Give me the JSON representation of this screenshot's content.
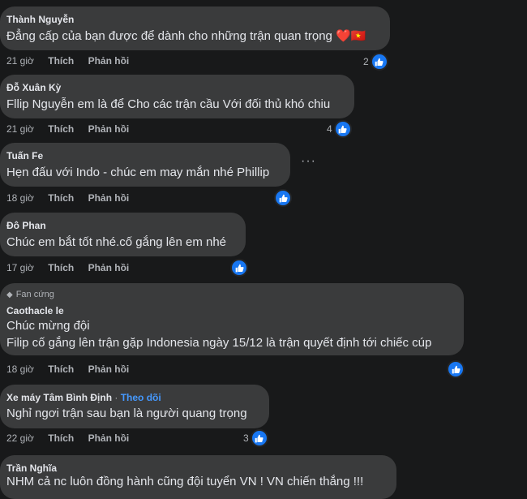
{
  "comments": [
    {
      "name": "Thành Nguyễn",
      "text": "Đẳng cấp của bạn được để dành cho những trận quan trọng",
      "emoji": "❤️🇻🇳",
      "time": "21 giờ",
      "like_label": "Thích",
      "reply_label": "Phản hồi",
      "reactions": "2"
    },
    {
      "name": "Đỗ Xuân Kỳ",
      "text": "Fllip Nguyễn em là để Cho các trận cầu Với đối thủ khó chiu",
      "time": "21 giờ",
      "like_label": "Thích",
      "reply_label": "Phản hồi",
      "reactions": "4"
    },
    {
      "name": "Tuấn Fe",
      "text": "Hẹn đấu với Indo - chúc em may mắn nhé Phillip",
      "time": "18 giờ",
      "like_label": "Thích",
      "reply_label": "Phản hồi",
      "reactions": "",
      "more": "···"
    },
    {
      "name": "Đô Phan",
      "text": "Chúc em bắt tốt nhé.cố gắng lên em nhé",
      "time": "17 giờ",
      "like_label": "Thích",
      "reply_label": "Phản hồi",
      "reactions": ""
    },
    {
      "badge": "Fan cứng",
      "name": "Caothacle le",
      "text1": "Chúc mừng đội",
      "text2": "Filip cố gắng lên trận gặp Indonesia ngày 15/12 là trận quyết định tới chiếc cúp",
      "time": "18 giờ",
      "like_label": "Thích",
      "reply_label": "Phản hồi",
      "reactions": ""
    },
    {
      "name": "Xe máy Tâm Bình Định",
      "separator": "·",
      "follow": "Theo dõi",
      "text": "Nghỉ ngơi trận sau bạn là người quang trọng",
      "time": "22 giờ",
      "like_label": "Thích",
      "reply_label": "Phản hồi",
      "reactions": "3"
    },
    {
      "name": "Trần Nghĩa",
      "text": "NHM cả nc luôn đồng hành cũng đội tuyển VN ! VN chiến thắng !!!"
    }
  ],
  "icons": {
    "reaction": "like-icon",
    "options": "more-options-icon",
    "badge": "diamond-icon"
  },
  "colors": {
    "background": "#18191a",
    "bubble": "#3a3b3c",
    "accent": "#1877f2",
    "follow": "#4599ff"
  }
}
